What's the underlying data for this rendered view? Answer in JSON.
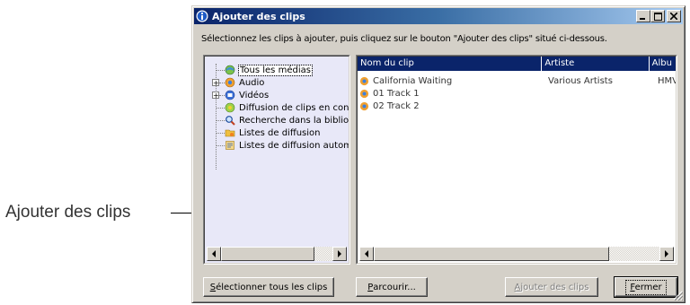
{
  "callout": {
    "label": "Ajouter des clips"
  },
  "window": {
    "title": "Ajouter des clips",
    "title_icon": "info-icon",
    "controls": {
      "minimize": "_",
      "maximize": "□",
      "close": "✕"
    }
  },
  "instruction": "Sélectionnez les clips à ajouter, puis cliquez sur le bouton \"Ajouter des clips\" situé ci-dessous.",
  "tree": {
    "items": [
      {
        "label": "Tous les médias",
        "icon": "media-globe-icon",
        "expander": ""
      },
      {
        "label": "Audio",
        "icon": "audio-icon",
        "expander": "+"
      },
      {
        "label": "Vidéos",
        "icon": "video-icon",
        "expander": "+"
      },
      {
        "label": "Diffusion de clips en cont",
        "icon": "stream-icon",
        "expander": ""
      },
      {
        "label": "Recherche dans la bibliot",
        "icon": "search-icon",
        "expander": ""
      },
      {
        "label": "Listes de diffusion",
        "icon": "playlist-folder-icon",
        "expander": ""
      },
      {
        "label": "Listes de diffusion automa",
        "icon": "auto-playlist-icon",
        "expander": ""
      }
    ]
  },
  "list": {
    "columns": [
      "Nom du clip",
      "Artiste",
      "Albu"
    ],
    "rows": [
      {
        "name": "California Waiting",
        "artist": "Various Artists",
        "album": "HMV"
      },
      {
        "name": "01 Track 1",
        "artist": "",
        "album": ""
      },
      {
        "name": "02 Track 2",
        "artist": "",
        "album": ""
      }
    ]
  },
  "buttons": {
    "select_all": {
      "ul": "S",
      "rest": "électionner tous les clips"
    },
    "browse": {
      "ul": "P",
      "rest": "arcourir..."
    },
    "add_clips": {
      "ul": "A",
      "rest": "jouter des clips"
    },
    "close": {
      "ul": "F",
      "rest": "ermer"
    }
  },
  "colors": {
    "title_start": "#0a246a",
    "title_end": "#a6caf0",
    "tree_bg": "#e8e8f8",
    "header_bg": "#0a246a",
    "face": "#d4d0c8"
  }
}
